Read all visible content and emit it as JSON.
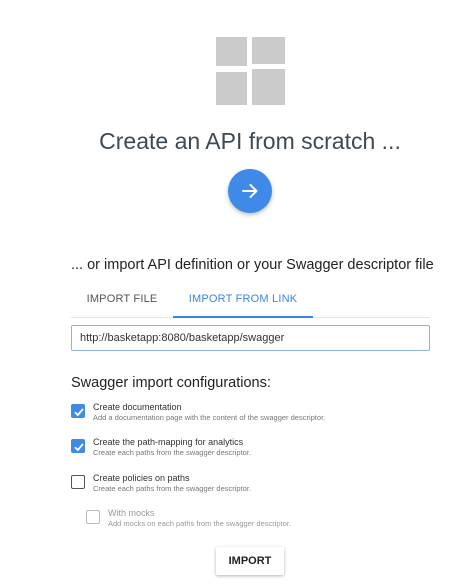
{
  "header": {
    "title": "Create an API from scratch ...",
    "create_button_icon": "arrow-right-icon",
    "logo_icon": "api-logo-icon"
  },
  "import_section": {
    "subtitle": "... or import API definition or your Swagger descriptor file",
    "tabs": [
      {
        "label": "IMPORT FILE",
        "active": false
      },
      {
        "label": "IMPORT FROM LINK",
        "active": true
      }
    ],
    "url_value": "http://basketapp:8080/basketapp/swagger"
  },
  "config": {
    "title": "Swagger import configurations:",
    "options": [
      {
        "label": "Create documentation",
        "description": "Add a documentation page with the content of the swagger descriptor.",
        "checked": true,
        "enabled": true
      },
      {
        "label": "Create the path-mapping for analytics",
        "description": "Create each paths from the swagger descriptor.",
        "checked": true,
        "enabled": true
      },
      {
        "label": "Create policies on paths",
        "description": "Create each paths from the swagger descriptor.",
        "checked": false,
        "enabled": true
      },
      {
        "label": "With mocks",
        "description": "Add mocks on each paths from the swagger descriptor.",
        "checked": false,
        "enabled": false
      }
    ]
  },
  "actions": {
    "import_label": "IMPORT"
  },
  "colors": {
    "accent": "#3f8ae8",
    "logo_gray": "#cbcbcb",
    "title": "#3c4a55"
  }
}
